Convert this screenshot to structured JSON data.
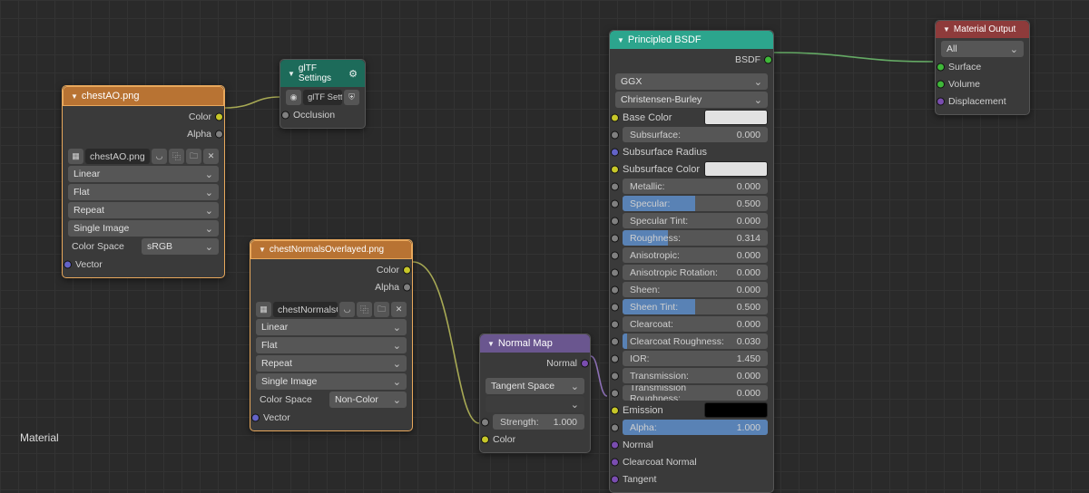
{
  "footer": "Material",
  "chestAO": {
    "title": "chestAO.png",
    "out_color": "Color",
    "out_alpha": "Alpha",
    "filename": "chestAO.png",
    "interp": "Linear",
    "projection": "Flat",
    "extension": "Repeat",
    "source": "Single Image",
    "cs_label": "Color Space",
    "cs_value": "sRGB",
    "vector": "Vector"
  },
  "gltf": {
    "title": "glTF Settings",
    "field": "glTF Setti..",
    "occlusion": "Occlusion"
  },
  "chestNormals": {
    "title": "chestNormalsOverlayed.png",
    "out_color": "Color",
    "out_alpha": "Alpha",
    "filename": "chestNormalsOv..",
    "interp": "Linear",
    "projection": "Flat",
    "extension": "Repeat",
    "source": "Single Image",
    "cs_label": "Color Space",
    "cs_value": "Non-Color",
    "vector": "Vector"
  },
  "normalMap": {
    "title": "Normal Map",
    "out_normal": "Normal",
    "space": "Tangent Space",
    "strength_label": "Strength:",
    "strength_value": "1.000",
    "color": "Color"
  },
  "bsdf": {
    "title": "Principled BSDF",
    "out": "BSDF",
    "dist": "GGX",
    "sss_method": "Christensen-Burley",
    "base_color": "Base Color",
    "subsurface_l": "Subsurface:",
    "subsurface_v": "0.000",
    "subsurface_radius": "Subsurface Radius",
    "subsurface_color": "Subsurface Color",
    "metallic_l": "Metallic:",
    "metallic_v": "0.000",
    "specular_l": "Specular:",
    "specular_v": "0.500",
    "spectint_l": "Specular Tint:",
    "spectint_v": "0.000",
    "roughness_l": "Roughness:",
    "roughness_v": "0.314",
    "aniso_l": "Anisotropic:",
    "aniso_v": "0.000",
    "anisorot_l": "Anisotropic Rotation:",
    "anisorot_v": "0.000",
    "sheen_l": "Sheen:",
    "sheen_v": "0.000",
    "sheentint_l": "Sheen Tint:",
    "sheentint_v": "0.500",
    "clearcoat_l": "Clearcoat:",
    "clearcoat_v": "0.000",
    "ccrough_l": "Clearcoat Roughness:",
    "ccrough_v": "0.030",
    "ior_l": "IOR:",
    "ior_v": "1.450",
    "trans_l": "Transmission:",
    "trans_v": "0.000",
    "transrough_l": "Transmission Roughness:",
    "transrough_v": "0.000",
    "emission": "Emission",
    "alpha_l": "Alpha:",
    "alpha_v": "1.000",
    "normal": "Normal",
    "clearcoat_normal": "Clearcoat Normal",
    "tangent": "Tangent"
  },
  "matout": {
    "title": "Material Output",
    "target": "All",
    "surface": "Surface",
    "volume": "Volume",
    "displacement": "Displacement"
  }
}
